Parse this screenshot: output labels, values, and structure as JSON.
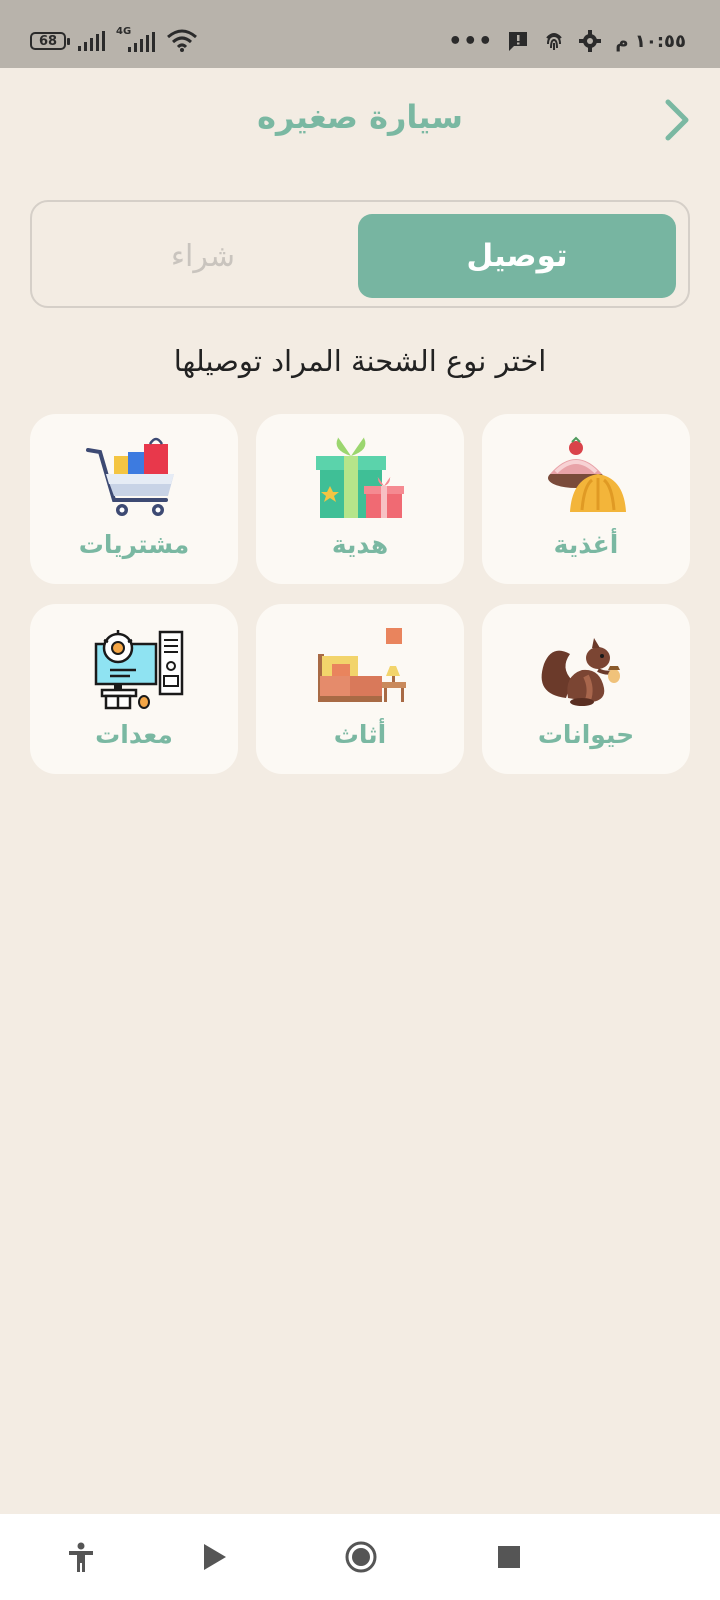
{
  "status_bar": {
    "battery": "68",
    "network": "4G",
    "time": "١٠:٥٥ م",
    "more": "•••"
  },
  "header": {
    "title": "سيارة صغيره"
  },
  "toggle": {
    "active": "توصيل",
    "inactive": "شراء"
  },
  "prompt": "اختر نوع الشحنة المراد توصيلها",
  "categories": [
    {
      "label": "أغذية",
      "icon": "pastry-icon"
    },
    {
      "label": "هدية",
      "icon": "gift-icon"
    },
    {
      "label": "مشتريات",
      "icon": "shopping-cart-icon"
    },
    {
      "label": "حيوانات",
      "icon": "squirrel-icon"
    },
    {
      "label": "أثاث",
      "icon": "furniture-icon"
    },
    {
      "label": "معدات",
      "icon": "equipment-icon"
    }
  ],
  "colors": {
    "accent": "#77b5a1",
    "background": "#f3ece3",
    "card": "#fcf9f4",
    "status_bar": "#b8b3ab"
  }
}
